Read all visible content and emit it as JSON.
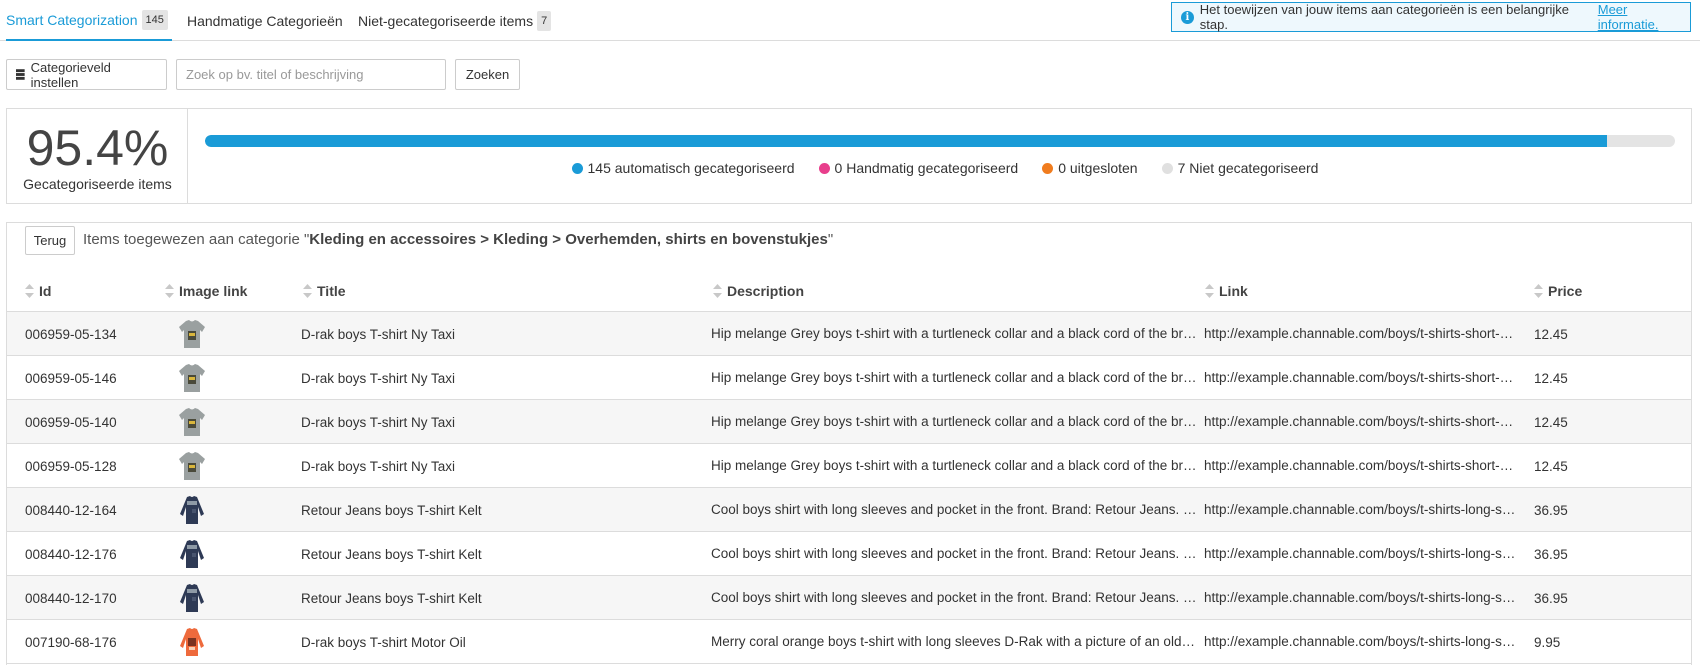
{
  "tabs": [
    {
      "label": "Smart Categorization",
      "count": "145"
    },
    {
      "label": "Handmatige Categorieën",
      "count": ""
    },
    {
      "label": "Niet-gecategoriseerde items",
      "count": "7"
    }
  ],
  "notice": {
    "text": "Het toewijzen van jouw items aan categorieën is een belangrijke stap.",
    "link": "Meer informatie."
  },
  "toolbar": {
    "category_field_label": "Categorieveld instellen",
    "search_placeholder": "Zoek op bv. titel of beschrijving",
    "search_label": "Zoeken"
  },
  "stats": {
    "percentage": "95.4%",
    "percentage_label": "Gecategoriseerde items",
    "progress_fraction": 0.954,
    "legend": [
      {
        "label": "145 automatisch gecategoriseerd",
        "color": "#1a9bd7"
      },
      {
        "label": "0 Handmatig gecategoriseerd",
        "color": "#e83e8c"
      },
      {
        "label": "0 uitgesloten",
        "color": "#f07c1e"
      },
      {
        "label": "7 Niet gecategoriseerd",
        "color": "#e0e0e0"
      }
    ]
  },
  "panel": {
    "back_label": "Terug",
    "breadcrumb_prefix": "Items toegewezen aan categorie \"",
    "breadcrumb_path": "Kleding en accessoires > Kleding > Overhemden, shirts en bovenstukjes",
    "breadcrumb_suffix": "\""
  },
  "columns": [
    "Id",
    "Image link",
    "Title",
    "Description",
    "Link",
    "Price"
  ],
  "rows": [
    {
      "id": "006959-05-134",
      "image": "grey-tshirt",
      "title": "D-rak boys T-shirt Ny Taxi",
      "description": "Hip melange Grey boys t-shirt with a turtleneck collar and a black cord of the br…",
      "link": "http://example.channable.com/boys/t-shirts-short-…",
      "price": "12.45"
    },
    {
      "id": "006959-05-146",
      "image": "grey-tshirt",
      "title": "D-rak boys T-shirt Ny Taxi",
      "description": "Hip melange Grey boys t-shirt with a turtleneck collar and a black cord of the br…",
      "link": "http://example.channable.com/boys/t-shirts-short-…",
      "price": "12.45"
    },
    {
      "id": "006959-05-140",
      "image": "grey-tshirt",
      "title": "D-rak boys T-shirt Ny Taxi",
      "description": "Hip melange Grey boys t-shirt with a turtleneck collar and a black cord of the br…",
      "link": "http://example.channable.com/boys/t-shirts-short-…",
      "price": "12.45"
    },
    {
      "id": "006959-05-128",
      "image": "grey-tshirt",
      "title": "D-rak boys T-shirt Ny Taxi",
      "description": "Hip melange Grey boys t-shirt with a turtleneck collar and a black cord of the br…",
      "link": "http://example.channable.com/boys/t-shirts-short-…",
      "price": "12.45"
    },
    {
      "id": "008440-12-164",
      "image": "navy-longsleeve",
      "title": "Retour Jeans boys T-shirt Kelt",
      "description": "Cool boys shirt with long sleeves and pocket in the front. Brand: Retour Jeans. …",
      "link": "http://example.channable.com/boys/t-shirts-long-s…",
      "price": "36.95"
    },
    {
      "id": "008440-12-176",
      "image": "navy-longsleeve",
      "title": "Retour Jeans boys T-shirt Kelt",
      "description": "Cool boys shirt with long sleeves and pocket in the front. Brand: Retour Jeans. …",
      "link": "http://example.channable.com/boys/t-shirts-long-s…",
      "price": "36.95"
    },
    {
      "id": "008440-12-170",
      "image": "navy-longsleeve",
      "title": "Retour Jeans boys T-shirt Kelt",
      "description": "Cool boys shirt with long sleeves and pocket in the front. Brand: Retour Jeans. …",
      "link": "http://example.channable.com/boys/t-shirts-long-s…",
      "price": "36.95"
    },
    {
      "id": "007190-68-176",
      "image": "orange-longsleeve",
      "title": "D-rak boys T-shirt Motor Oil",
      "description": "Merry coral orange boys t-shirt with long sleeves D-Rak with a picture of an old …",
      "link": "http://example.channable.com/boys/t-shirts-long-s…",
      "price": "9.95"
    }
  ]
}
